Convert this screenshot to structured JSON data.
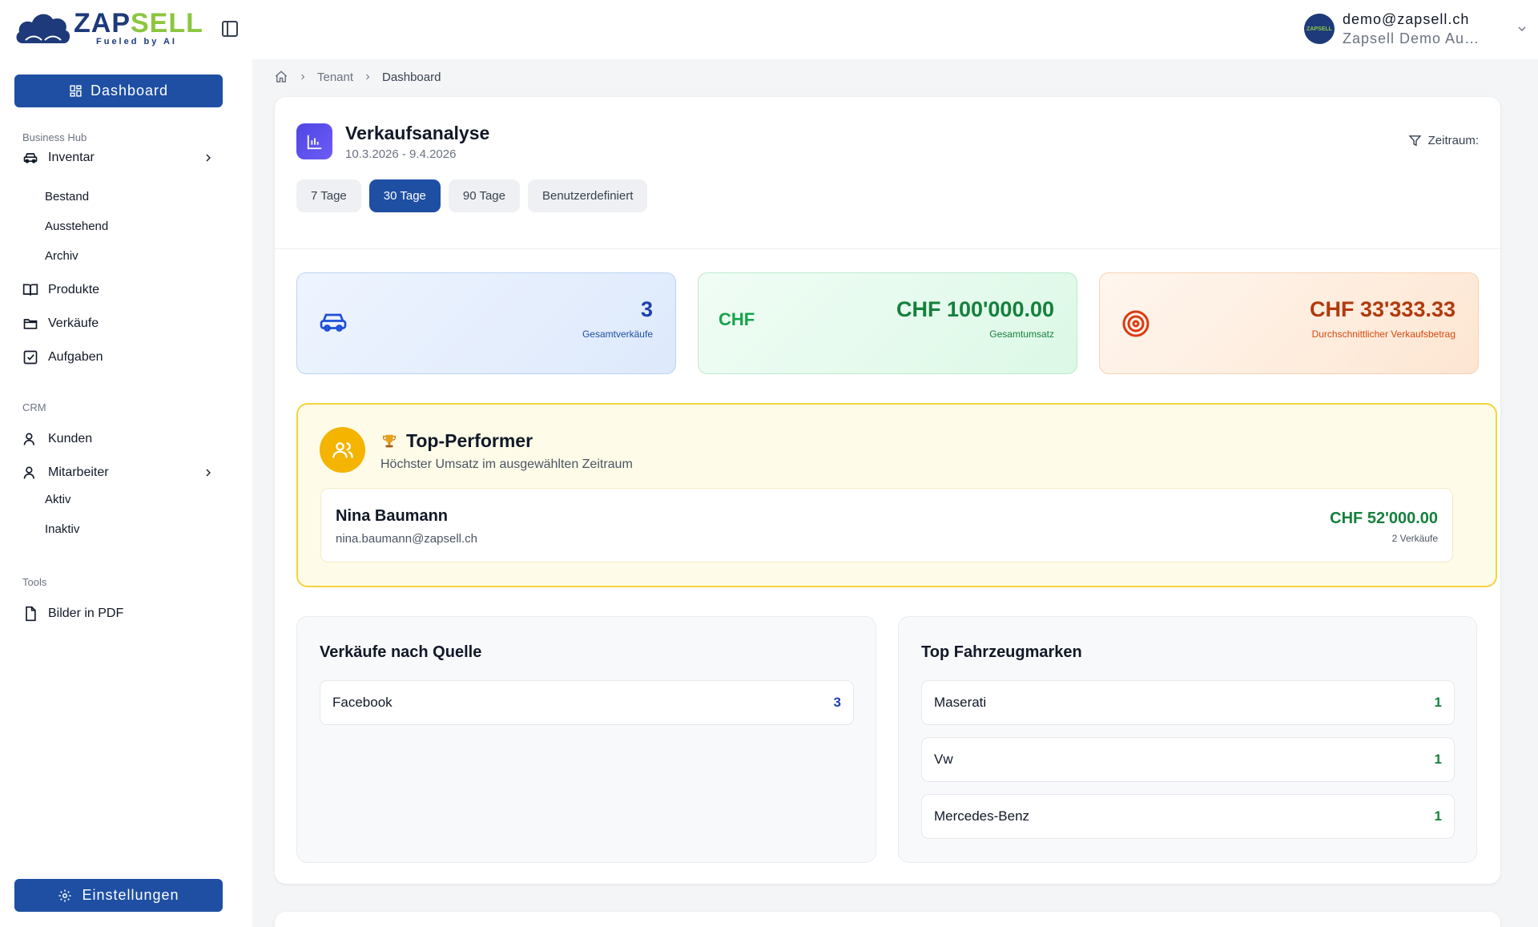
{
  "brand": {
    "name_part1": "ZAP",
    "name_part2": "SELL",
    "tagline": "Fueled by AI"
  },
  "user": {
    "email": "demo@zapsell.ch",
    "company": "Zapsell Demo Autohaus",
    "avatar_text": "ZAPSELL"
  },
  "sidebar": {
    "dashboard_label": "Dashboard",
    "section_business": "Business Hub",
    "inventar": "Inventar",
    "inventar_sub": [
      "Bestand",
      "Ausstehend",
      "Archiv"
    ],
    "produkte": "Produkte",
    "verkaeufe": "Verkäufe",
    "aufgaben": "Aufgaben",
    "section_crm": "CRM",
    "kunden": "Kunden",
    "mitarbeiter": "Mitarbeiter",
    "mitarbeiter_sub": [
      "Aktiv",
      "Inaktiv"
    ],
    "section_tools": "Tools",
    "bilder_pdf": "Bilder in PDF",
    "settings_label": "Einstellungen"
  },
  "breadcrumb": {
    "tenant": "Tenant",
    "current": "Dashboard"
  },
  "analysis": {
    "title": "Verkaufsanalyse",
    "date_range": "10.3.2026 - 9.4.2026",
    "filter_label": "Zeitraum:",
    "periods": [
      "7 Tage",
      "30 Tage",
      "90 Tage",
      "Benutzerdefiniert"
    ],
    "active_period": "30 Tage"
  },
  "stats": {
    "total_sales_value": "3",
    "total_sales_label": "Gesamtverkäufe",
    "currency_icon": "CHF",
    "revenue_value": "CHF 100'000.00",
    "revenue_label": "Gesamtumsatz",
    "avg_value": "CHF 33'333.33",
    "avg_label": "Durchschnittlicher Verkaufsbetrag"
  },
  "top_performer": {
    "title": "Top-Performer",
    "subtitle": "Höchster Umsatz im ausgewählten Zeitraum",
    "name": "Nina Baumann",
    "email": "nina.baumann@zapsell.ch",
    "amount": "CHF 52'000.00",
    "sales_count": "2 Verkäufe"
  },
  "sales_by_source": {
    "title": "Verkäufe nach Quelle",
    "rows": [
      {
        "label": "Facebook",
        "count": "3"
      }
    ]
  },
  "top_brands": {
    "title": "Top Fahrzeugmarken",
    "rows": [
      {
        "label": "Maserati",
        "count": "1"
      },
      {
        "label": "Vw",
        "count": "1"
      },
      {
        "label": "Mercedes-Benz",
        "count": "1"
      }
    ]
  },
  "colors": {
    "primary": "#1e4fa3",
    "accent_green": "#8cc63f",
    "blue_value": "#1e40af",
    "green_value": "#15803d",
    "orange_value": "#b03a0e",
    "performer_border": "#f5d33b",
    "performer_icon": "#f4b400"
  }
}
